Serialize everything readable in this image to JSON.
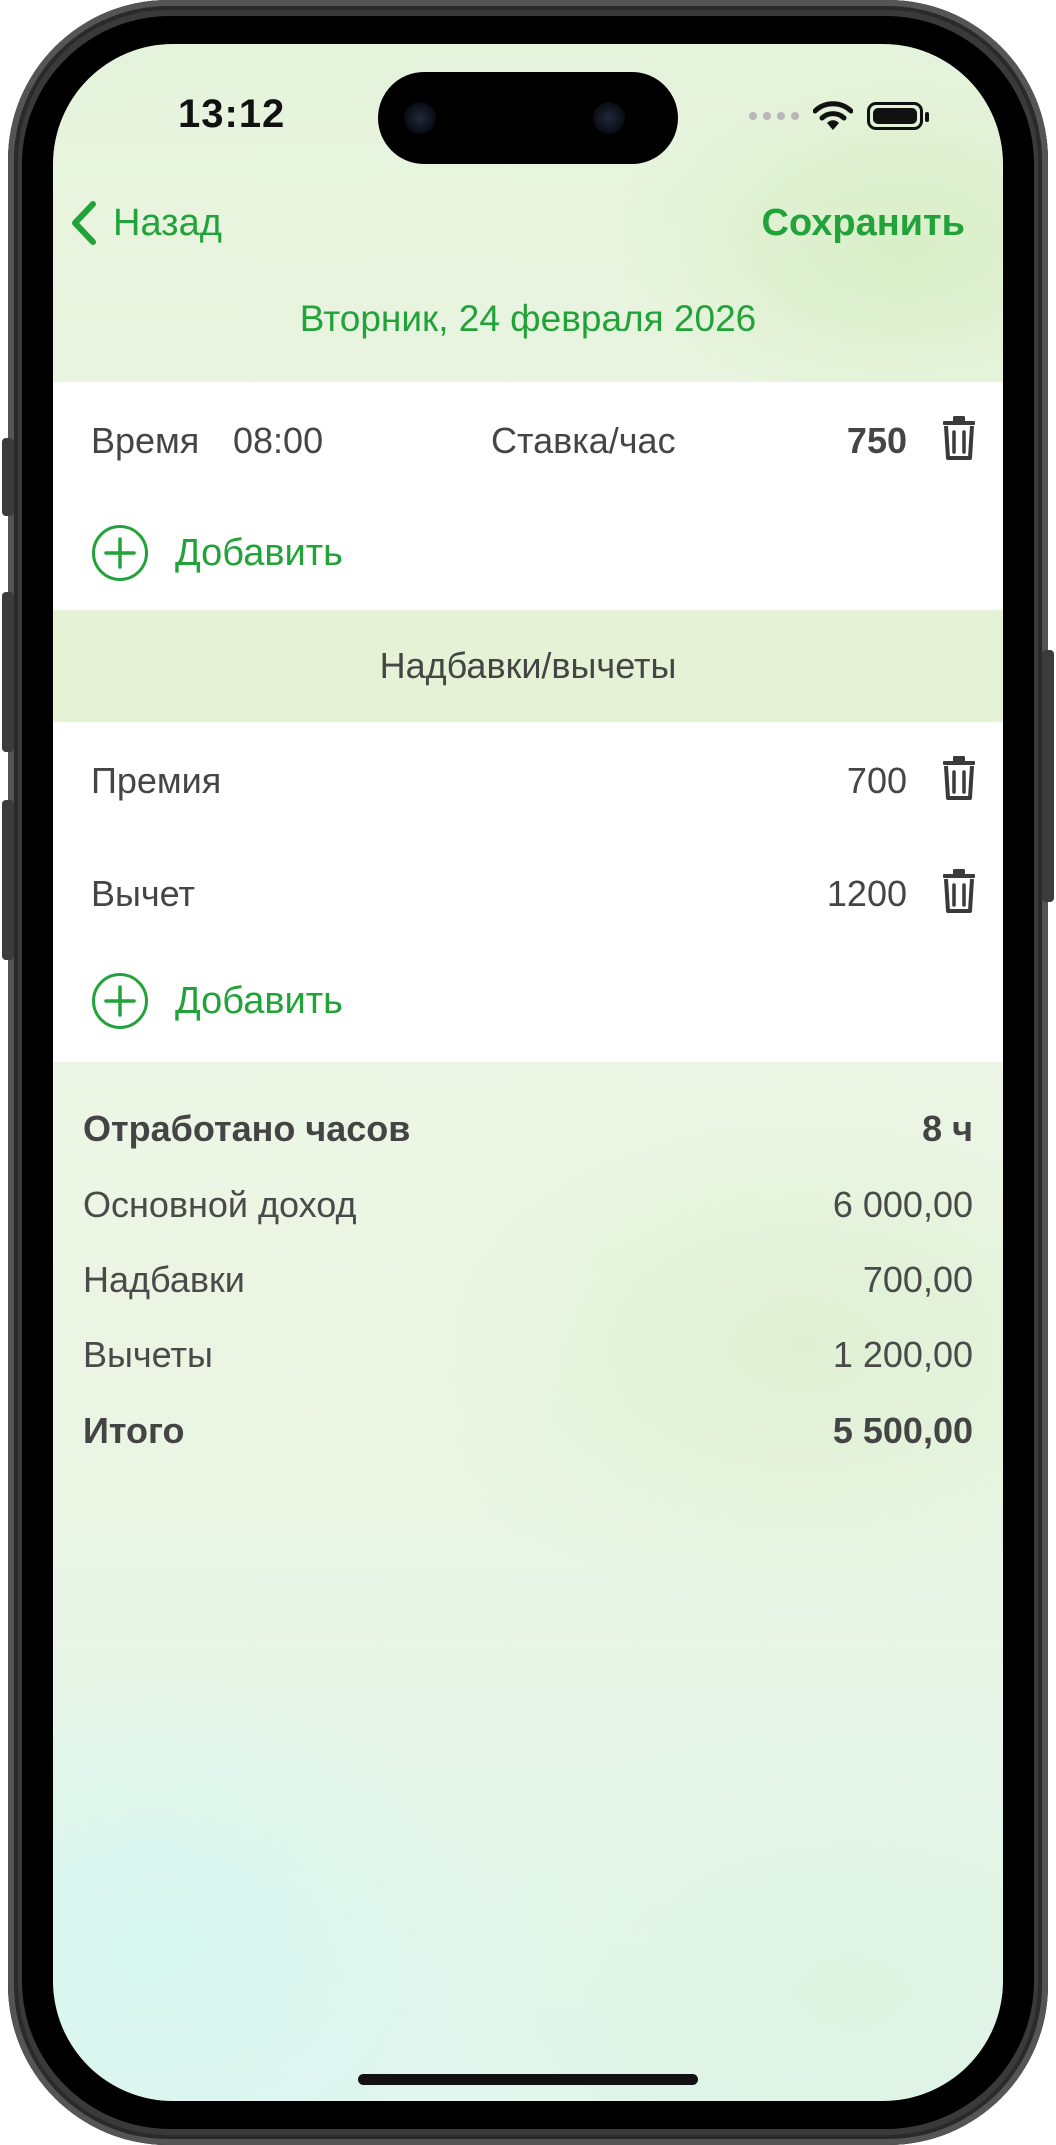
{
  "status_bar": {
    "time": "13:12"
  },
  "nav": {
    "back_label": "Назад",
    "save_label": "Сохранить"
  },
  "date_title": "Вторник, 24 февраля 2026",
  "time_row": {
    "time_label": "Время",
    "time_value": "08:00",
    "rate_label": "Ставка/час",
    "rate_value": "750"
  },
  "add_label": "Добавить",
  "adjustments": {
    "header": "Надбавки/вычеты",
    "items": [
      {
        "label": "Премия",
        "value": "700"
      },
      {
        "label": "Вычет",
        "value": "1200"
      }
    ],
    "add_label": "Добавить"
  },
  "summary": {
    "hours_label": "Отработано часов",
    "hours_value": "8 ч",
    "base_label": "Основной доход",
    "base_value": "6 000,00",
    "bonus_label": "Надбавки",
    "bonus_value": "700,00",
    "deduct_label": "Вычеты",
    "deduct_value": "1 200,00",
    "total_label": "Итого",
    "total_value": "5 500,00"
  },
  "colors": {
    "accent": "#21a33a",
    "section_header_bg": "#e5f2d6",
    "text": "#454545"
  },
  "icons": {
    "back": "chevron-left-icon",
    "delete": "trash-icon",
    "add": "plus-circle-icon",
    "wifi": "wifi-icon",
    "battery": "battery-icon"
  }
}
